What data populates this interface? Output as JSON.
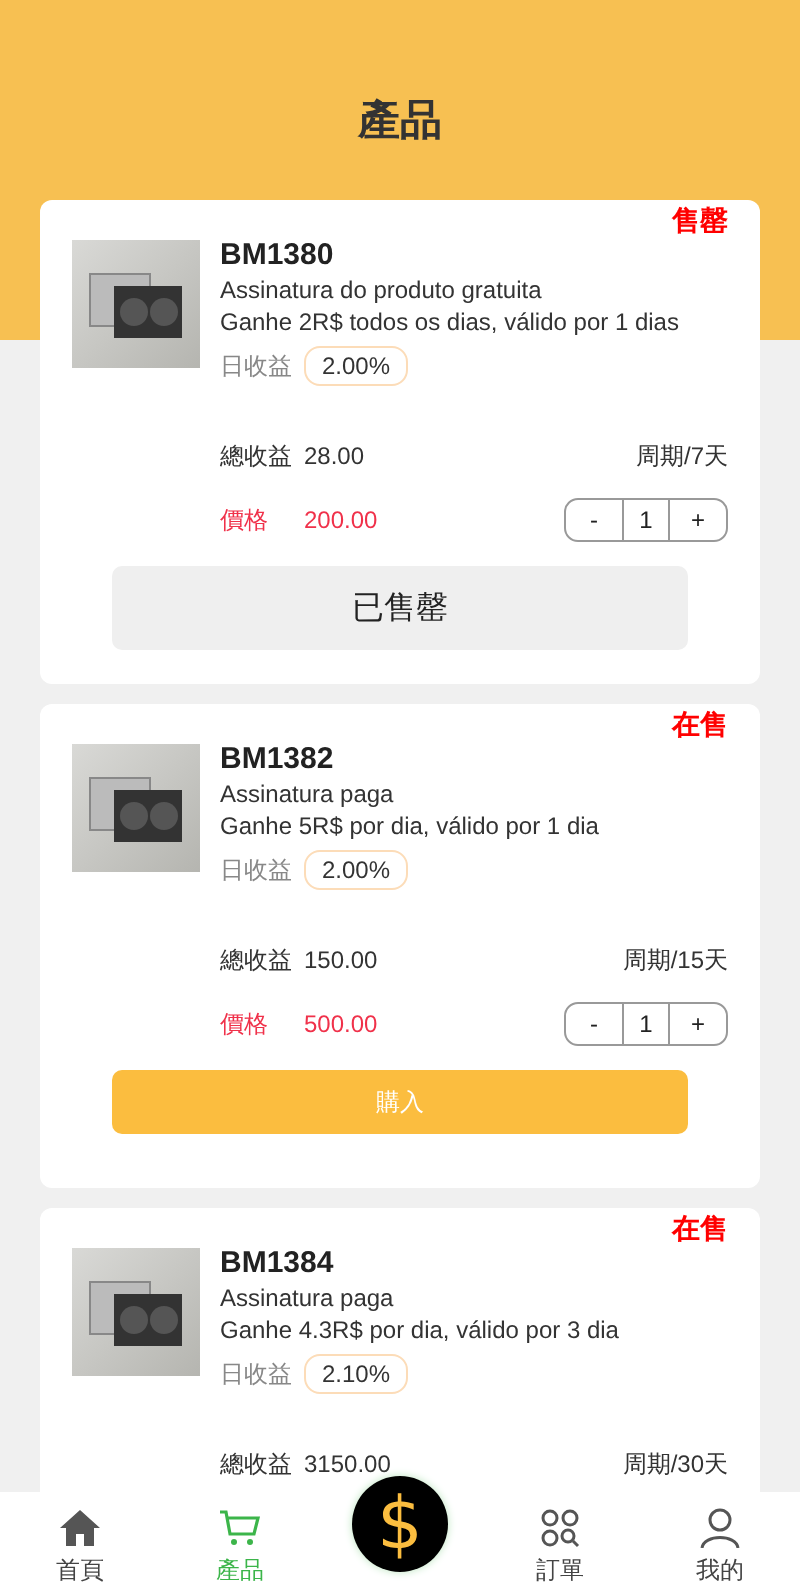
{
  "header": {
    "title": "產品"
  },
  "products": [
    {
      "status": "售罄",
      "name": "BM1380",
      "plan": "Assinatura do produto gratuita",
      "desc": "Ganhe 2R$ todos os dias, válido por 1 dias",
      "daily_label": "日收益",
      "daily_rate": "2.00%",
      "total_label": "總收益",
      "total": "28.00",
      "period": "周期/7天",
      "price_label": "價格",
      "price": "200.00",
      "qty": {
        "minus": "-",
        "value": "1",
        "plus": "+"
      },
      "button": {
        "label": "已售罄",
        "kind": "sold"
      }
    },
    {
      "status": "在售",
      "name": "BM1382",
      "plan": "Assinatura paga",
      "desc": "Ganhe 5R$ por dia, válido por 1 dia",
      "daily_label": "日收益",
      "daily_rate": "2.00%",
      "total_label": "總收益",
      "total": "150.00",
      "period": "周期/15天",
      "price_label": "價格",
      "price": "500.00",
      "qty": {
        "minus": "-",
        "value": "1",
        "plus": "+"
      },
      "button": {
        "label": "購入",
        "kind": "buy"
      }
    },
    {
      "status": "在售",
      "name": "BM1384",
      "plan": "Assinatura paga",
      "desc": "Ganhe 4.3R$ por dia, válido por 3 dia",
      "daily_label": "日收益",
      "daily_rate": "2.10%",
      "total_label": "總收益",
      "total": "3150.00",
      "period": "周期/30天"
    }
  ],
  "nav": [
    {
      "kind": "home",
      "label": "首頁",
      "selected": false
    },
    {
      "kind": "cart",
      "label": "產品",
      "selected": true
    },
    {
      "kind": "center",
      "symbol": "$"
    },
    {
      "kind": "orders",
      "label": "訂單",
      "selected": false
    },
    {
      "kind": "profile",
      "label": "我的",
      "selected": false
    }
  ]
}
